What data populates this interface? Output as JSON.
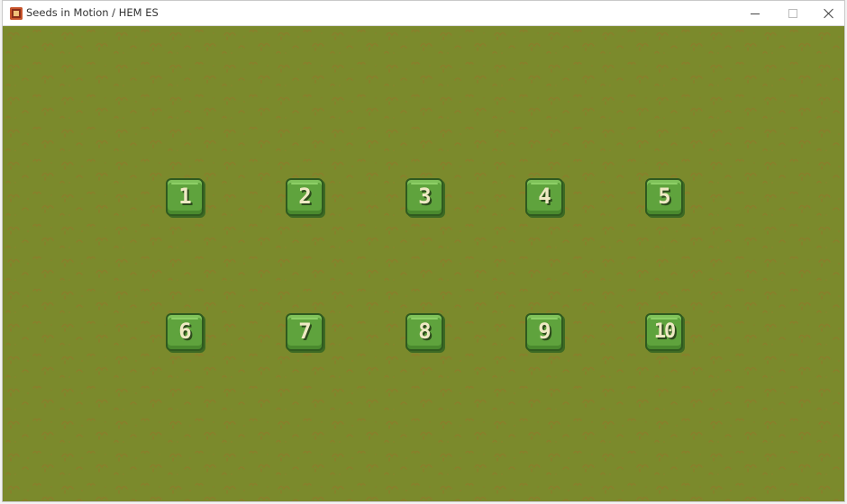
{
  "window": {
    "title": "Seeds in Motion / HEM ES",
    "icon": "game-app-icon",
    "controls": [
      "minimize-icon",
      "maximize-icon",
      "close-icon"
    ]
  },
  "game": {
    "background_color": "#7b8a2c",
    "pattern_color": "#8a7a2a",
    "levels": [
      {
        "label": "1"
      },
      {
        "label": "2"
      },
      {
        "label": "3"
      },
      {
        "label": "4"
      },
      {
        "label": "5"
      },
      {
        "label": "6"
      },
      {
        "label": "7"
      },
      {
        "label": "8"
      },
      {
        "label": "9"
      },
      {
        "label": "10"
      }
    ]
  }
}
